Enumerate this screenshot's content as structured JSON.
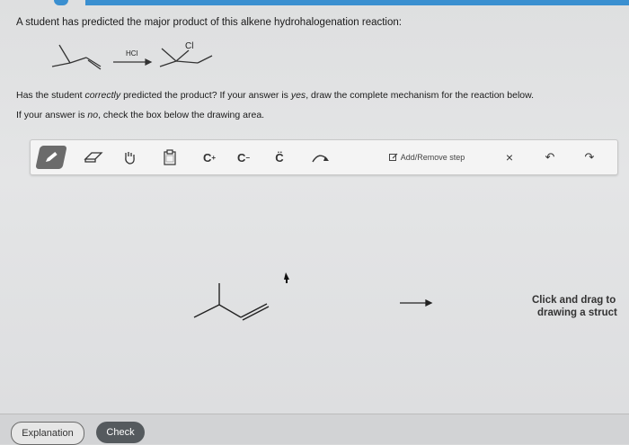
{
  "question": {
    "text": "A student has predicted the major product of this alkene hydrohalogenation reaction:",
    "reagent": "HCl",
    "product_substituent": "Cl"
  },
  "prompts": {
    "line1_start": "Has the student ",
    "line1_italic": "correctly",
    "line1_mid": " predicted the product? If your answer is ",
    "line1_yes": "yes",
    "line1_end": ", draw the complete mechanism for the reaction below.",
    "line2_start": "If your answer is ",
    "line2_no": "no",
    "line2_end": ", check the box below the drawing area."
  },
  "toolbar": {
    "tools": [
      "pencil",
      "eraser",
      "hand",
      "clipboard",
      "c-plus",
      "c-minus",
      "lone-pair",
      "curved-arrow"
    ],
    "cplus_base": "C",
    "cplus_sup": "+",
    "cminus_base": "C",
    "cminus_sup": "−",
    "lone_pair": "C̈",
    "add_step_label": "Add/Remove step",
    "close_glyph": "×",
    "undo_glyph": "↶",
    "redo_glyph": "↷"
  },
  "canvas": {
    "drag_hint_line1": "Click and drag to",
    "drag_hint_line2": "drawing a struct"
  },
  "footer": {
    "explanation_label": "Explanation",
    "check_label": "Check"
  },
  "colors": {
    "accent": "#3a8fd0",
    "check_button": "#555a5e",
    "toolbar_bg": "#f4f4f4"
  }
}
